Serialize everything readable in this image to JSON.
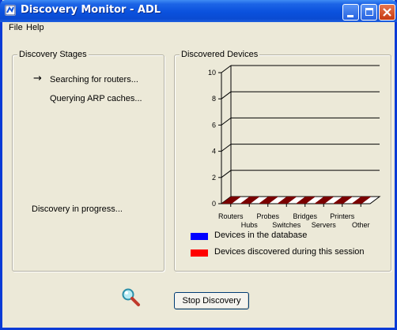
{
  "window": {
    "title": "Discovery Monitor - ADL"
  },
  "menu": {
    "items": [
      "File",
      "Help"
    ]
  },
  "stages": {
    "title": "Discovery Stages",
    "lines": [
      "Searching for routers...",
      "Querying ARP caches..."
    ],
    "active_index": 0,
    "status": "Discovery in progress..."
  },
  "devices": {
    "title": "Discovered Devices",
    "legend": [
      {
        "label": "Devices in the database",
        "color": "#0000ff"
      },
      {
        "label": "Devices discovered during this session",
        "color": "#ff0000"
      }
    ]
  },
  "chart_data": {
    "type": "bar",
    "categories": [
      "Routers",
      "Hubs",
      "Probes",
      "Switches",
      "Bridges",
      "Servers",
      "Printers",
      "Other"
    ],
    "series": [
      {
        "name": "Devices in the database",
        "values": [
          0,
          0,
          0,
          0,
          0,
          0,
          0,
          0
        ],
        "color": "#0000ff"
      },
      {
        "name": "Devices discovered during this session",
        "values": [
          0,
          0,
          0,
          0,
          0,
          0,
          0,
          0
        ],
        "color": "#ff0000"
      }
    ],
    "yticks": [
      "0",
      "2",
      "4",
      "6",
      "8",
      "10"
    ],
    "ylim": [
      0,
      10
    ],
    "grid": true,
    "floor_color": "#7a0000"
  },
  "actions": {
    "stop_label": "Stop Discovery"
  }
}
